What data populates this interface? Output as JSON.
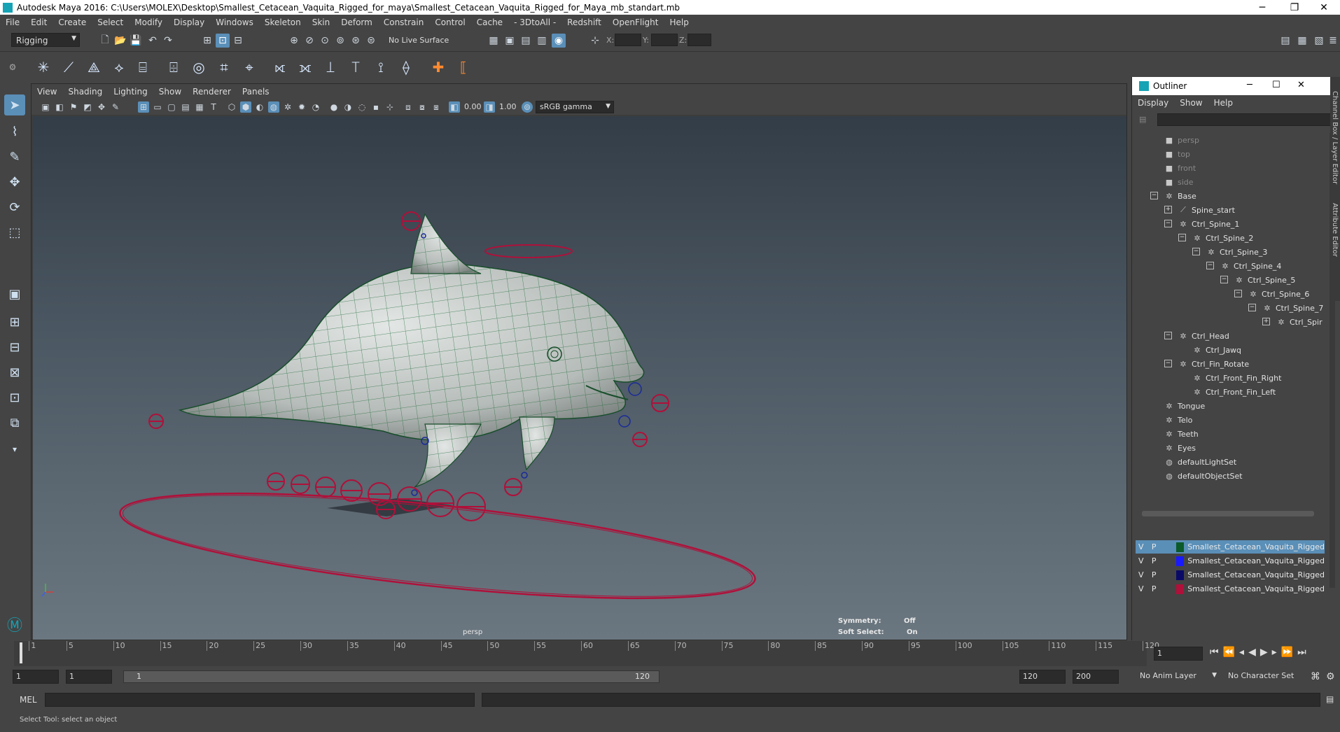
{
  "window": {
    "title": "Autodesk Maya 2016: C:\\Users\\MOLEX\\Desktop\\Smallest_Cetacean_Vaquita_Rigged_for_maya\\Smallest_Cetacean_Vaquita_Rigged_for_Maya_mb_standart.mb",
    "minimize": "─",
    "restore": "❐",
    "close": "✕"
  },
  "menubar": [
    "File",
    "Edit",
    "Create",
    "Select",
    "Modify",
    "Display",
    "Windows",
    "Skeleton",
    "Skin",
    "Deform",
    "Constrain",
    "Control",
    "Cache",
    "- 3DtoAll -",
    "Redshift",
    "OpenFlight",
    "Help"
  ],
  "statusline": {
    "menuset": "Rigging",
    "live_surface": "No Live Surface",
    "x_label": "X:",
    "y_label": "Y:",
    "z_label": "Z:"
  },
  "viewport": {
    "menu": [
      "View",
      "Shading",
      "Lighting",
      "Show",
      "Renderer",
      "Panels"
    ],
    "exposure": "0.00",
    "gamma": "1.00",
    "color_space": "sRGB gamma",
    "camera_label": "persp",
    "hud": {
      "symmetry_label": "Symmetry:",
      "symmetry_value": "Off",
      "soft_select_label": "Soft Select:",
      "soft_select_value": "On"
    }
  },
  "outliner": {
    "title": "Outliner",
    "menu": [
      "Display",
      "Show",
      "Help"
    ],
    "items": [
      {
        "label": "persp",
        "depth": 0,
        "icon": "camera-icon",
        "dim": true,
        "exp": ""
      },
      {
        "label": "top",
        "depth": 0,
        "icon": "camera-icon",
        "dim": true,
        "exp": ""
      },
      {
        "label": "front",
        "depth": 0,
        "icon": "camera-icon",
        "dim": true,
        "exp": ""
      },
      {
        "label": "side",
        "depth": 0,
        "icon": "camera-icon",
        "dim": true,
        "exp": ""
      },
      {
        "label": "Base",
        "depth": 0,
        "icon": "curve-icon",
        "dim": false,
        "exp": "−"
      },
      {
        "label": "Spine_start",
        "depth": 1,
        "icon": "joint-icon",
        "dim": false,
        "exp": "+"
      },
      {
        "label": "Ctrl_Spine_1",
        "depth": 1,
        "icon": "curve-icon",
        "dim": false,
        "exp": "−"
      },
      {
        "label": "Ctrl_Spine_2",
        "depth": 2,
        "icon": "curve-icon",
        "dim": false,
        "exp": "−"
      },
      {
        "label": "Ctrl_Spine_3",
        "depth": 3,
        "icon": "curve-icon",
        "dim": false,
        "exp": "−"
      },
      {
        "label": "Ctrl_Spine_4",
        "depth": 4,
        "icon": "curve-icon",
        "dim": false,
        "exp": "−"
      },
      {
        "label": "Ctrl_Spine_5",
        "depth": 5,
        "icon": "curve-icon",
        "dim": false,
        "exp": "−"
      },
      {
        "label": "Ctrl_Spine_6",
        "depth": 6,
        "icon": "curve-icon",
        "dim": false,
        "exp": "−"
      },
      {
        "label": "Ctrl_Spine_7",
        "depth": 7,
        "icon": "curve-icon",
        "dim": false,
        "exp": "−"
      },
      {
        "label": "Ctrl_Spir",
        "depth": 8,
        "icon": "curve-icon",
        "dim": false,
        "exp": "+"
      },
      {
        "label": "Ctrl_Head",
        "depth": 1,
        "icon": "curve-icon",
        "dim": false,
        "exp": "−"
      },
      {
        "label": "Ctrl_Jawq",
        "depth": 2,
        "icon": "curve-icon",
        "dim": false,
        "exp": ""
      },
      {
        "label": "Ctrl_Fin_Rotate",
        "depth": 1,
        "icon": "curve-icon",
        "dim": false,
        "exp": "−"
      },
      {
        "label": "Ctrl_Front_Fin_Right",
        "depth": 2,
        "icon": "curve-icon",
        "dim": false,
        "exp": ""
      },
      {
        "label": "Ctrl_Front_Fin_Left",
        "depth": 2,
        "icon": "curve-icon",
        "dim": false,
        "exp": ""
      },
      {
        "label": "Tongue",
        "depth": 0,
        "icon": "mesh-icon",
        "dim": false,
        "exp": ""
      },
      {
        "label": "Telo",
        "depth": 0,
        "icon": "mesh-icon",
        "dim": false,
        "exp": ""
      },
      {
        "label": "Teeth",
        "depth": 0,
        "icon": "mesh-icon",
        "dim": false,
        "exp": ""
      },
      {
        "label": "Eyes",
        "depth": 0,
        "icon": "mesh-icon",
        "dim": false,
        "exp": ""
      },
      {
        "label": "defaultLightSet",
        "depth": 0,
        "icon": "set-icon",
        "dim": false,
        "exp": ""
      },
      {
        "label": "defaultObjectSet",
        "depth": 0,
        "icon": "set-icon",
        "dim": false,
        "exp": ""
      }
    ]
  },
  "layers": [
    {
      "v": "V",
      "p": "P",
      "color": "#0b5a2a",
      "name": "Smallest_Cetacean_Vaquita_Rigged",
      "selected": true
    },
    {
      "v": "V",
      "p": "P",
      "color": "#1a1aff",
      "name": "Smallest_Cetacean_Vaquita_Rigged",
      "selected": false
    },
    {
      "v": "V",
      "p": "P",
      "color": "#0a0a66",
      "name": "Smallest_Cetacean_Vaquita_Rigged",
      "selected": false
    },
    {
      "v": "V",
      "p": "P",
      "color": "#b0103a",
      "name": "Smallest_Cetacean_Vaquita_Rigged",
      "selected": false
    }
  ],
  "side_tabs": [
    "Channel Box / Layer Editor",
    "Attribute Editor"
  ],
  "timeline": {
    "ticks": [
      "1",
      "5",
      "10",
      "15",
      "20",
      "25",
      "30",
      "35",
      "40",
      "45",
      "50",
      "55",
      "60",
      "65",
      "70",
      "75",
      "80",
      "85",
      "90",
      "95",
      "100",
      "105",
      "110",
      "115",
      "120"
    ],
    "current_frame": "1"
  },
  "range": {
    "start": "1",
    "playback_start": "1",
    "slider_start": "1",
    "slider_end": "120",
    "playback_end": "120",
    "end": "200",
    "anim_layer": "No Anim Layer",
    "char_set": "No Character Set"
  },
  "cmd": {
    "label": "MEL"
  },
  "help_line": "Select Tool: select an object"
}
